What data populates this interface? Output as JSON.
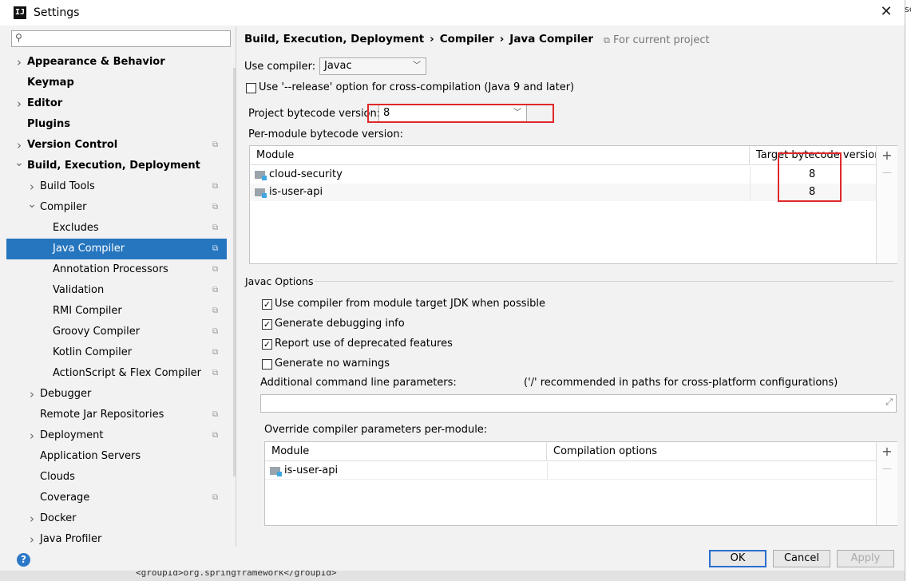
{
  "window": {
    "title": "Settings",
    "app_icon": "IJ",
    "edge_text": "se"
  },
  "search": {
    "placeholder": ""
  },
  "sidebar": {
    "items": [
      {
        "label": "Appearance & Behavior",
        "arrow": "right",
        "level": 0,
        "bold": true,
        "project": false
      },
      {
        "label": "Keymap",
        "arrow": "",
        "level": 0,
        "bold": true,
        "project": false
      },
      {
        "label": "Editor",
        "arrow": "right",
        "level": 0,
        "bold": true,
        "project": false
      },
      {
        "label": "Plugins",
        "arrow": "",
        "level": 0,
        "bold": true,
        "project": false
      },
      {
        "label": "Version Control",
        "arrow": "right",
        "level": 0,
        "bold": true,
        "project": true
      },
      {
        "label": "Build, Execution, Deployment",
        "arrow": "down",
        "level": 0,
        "bold": true,
        "project": false
      },
      {
        "label": "Build Tools",
        "arrow": "right",
        "level": 1,
        "bold": false,
        "project": true
      },
      {
        "label": "Compiler",
        "arrow": "down",
        "level": 1,
        "bold": false,
        "project": true
      },
      {
        "label": "Excludes",
        "arrow": "",
        "level": 2,
        "bold": false,
        "project": true
      },
      {
        "label": "Java Compiler",
        "arrow": "",
        "level": 2,
        "bold": false,
        "project": true,
        "selected": true
      },
      {
        "label": "Annotation Processors",
        "arrow": "",
        "level": 2,
        "bold": false,
        "project": true
      },
      {
        "label": "Validation",
        "arrow": "",
        "level": 2,
        "bold": false,
        "project": true
      },
      {
        "label": "RMI Compiler",
        "arrow": "",
        "level": 2,
        "bold": false,
        "project": true
      },
      {
        "label": "Groovy Compiler",
        "arrow": "",
        "level": 2,
        "bold": false,
        "project": true
      },
      {
        "label": "Kotlin Compiler",
        "arrow": "",
        "level": 2,
        "bold": false,
        "project": true
      },
      {
        "label": "ActionScript & Flex Compiler",
        "arrow": "",
        "level": 2,
        "bold": false,
        "project": true
      },
      {
        "label": "Debugger",
        "arrow": "right",
        "level": 1,
        "bold": false,
        "project": false
      },
      {
        "label": "Remote Jar Repositories",
        "arrow": "",
        "level": 1,
        "bold": false,
        "project": true
      },
      {
        "label": "Deployment",
        "arrow": "right",
        "level": 1,
        "bold": false,
        "project": true
      },
      {
        "label": "Application Servers",
        "arrow": "",
        "level": 1,
        "bold": false,
        "project": false
      },
      {
        "label": "Clouds",
        "arrow": "",
        "level": 1,
        "bold": false,
        "project": false
      },
      {
        "label": "Coverage",
        "arrow": "",
        "level": 1,
        "bold": false,
        "project": true
      },
      {
        "label": "Docker",
        "arrow": "right",
        "level": 1,
        "bold": false,
        "project": false
      },
      {
        "label": "Java Profiler",
        "arrow": "right",
        "level": 1,
        "bold": false,
        "project": false
      }
    ]
  },
  "main": {
    "breadcrumb": [
      "Build, Execution, Deployment",
      "Compiler",
      "Java Compiler"
    ],
    "breadcrumb_sep": "›",
    "for_current_project": "For current project",
    "use_compiler_label": "Use compiler:",
    "use_compiler_value": "Javac",
    "release_option": {
      "label": "Use '--release' option for cross-compilation (Java 9 and later)",
      "checked": false
    },
    "bytecode_label": "Project bytecode version:",
    "bytecode_value": "8",
    "per_module_label": "Per-module bytecode version:",
    "module_table": {
      "col_module": "Module",
      "col_target": "Target bytecode version",
      "rows": [
        {
          "module": "cloud-security",
          "target": "8"
        },
        {
          "module": "is-user-api",
          "target": "8"
        }
      ]
    },
    "javac_options_title": "Javac Options",
    "options": [
      {
        "label": "Use compiler from module target JDK when possible",
        "checked": true
      },
      {
        "label": "Generate debugging info",
        "checked": true
      },
      {
        "label": "Report use of deprecated features",
        "checked": true
      },
      {
        "label": "Generate no warnings",
        "checked": false
      }
    ],
    "additional_params_label": "Additional command line parameters:",
    "additional_params_hint": "('/' recommended in paths for cross-platform configurations)",
    "additional_params_value": "",
    "override_label": "Override compiler parameters per-module:",
    "override_table": {
      "col_module": "Module",
      "col_options": "Compilation options",
      "rows": [
        {
          "module": "is-user-api",
          "options": ""
        }
      ]
    },
    "add_symbol": "+",
    "remove_symbol": "—"
  },
  "buttons": {
    "ok": "OK",
    "cancel": "Cancel",
    "apply": "Apply",
    "help": "?"
  },
  "taskbar_text": "<groupId>org.springframework</groupId>",
  "colors": {
    "selection": "#2675bf",
    "highlight_box": "#e0282a",
    "ok_border": "#2b6fd0"
  },
  "icons": {
    "close": "close-icon",
    "search": "search-icon",
    "folder": "module-folder-icon",
    "project": "project-scope-icon"
  }
}
